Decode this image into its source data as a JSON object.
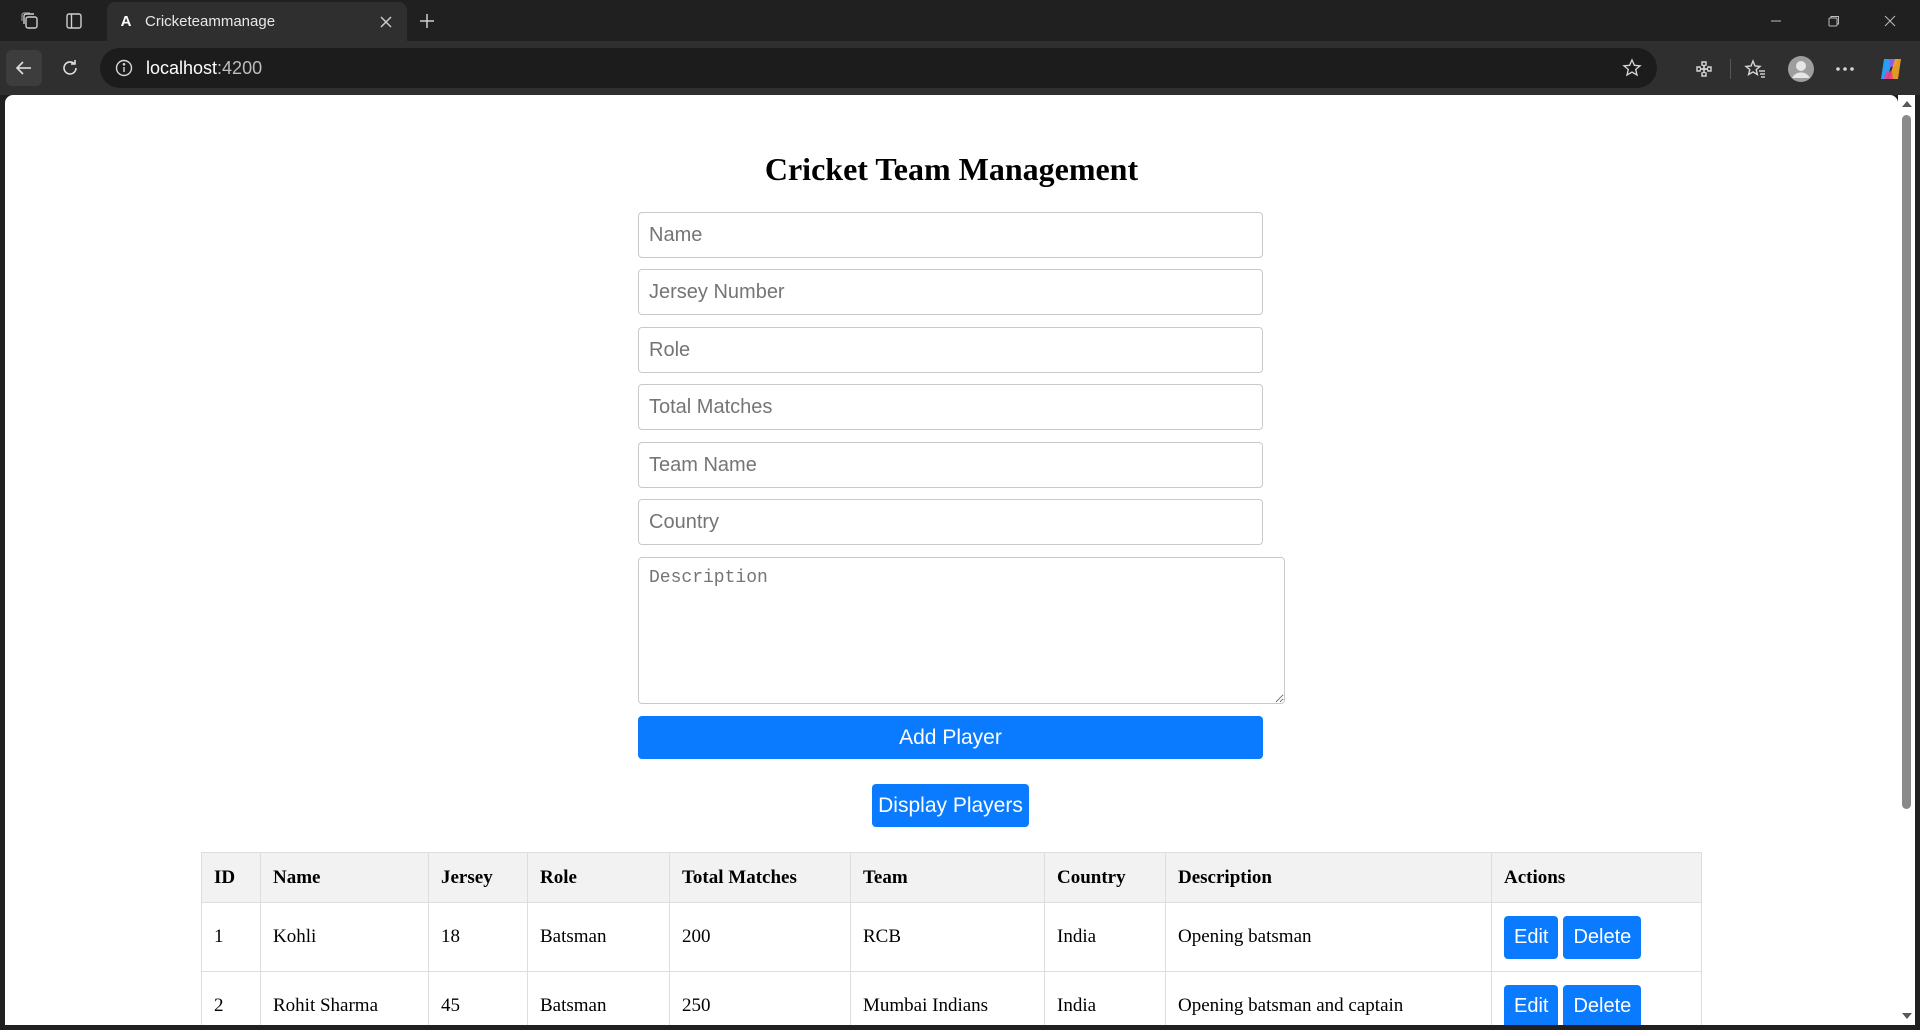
{
  "browser": {
    "tab_title": "Cricketeammanage",
    "tab_favicon": "A",
    "url_host": "localhost",
    "url_port": ":4200"
  },
  "page": {
    "title": "Cricket Team Management",
    "form": {
      "name_placeholder": "Name",
      "jersey_placeholder": "Jersey Number",
      "role_placeholder": "Role",
      "matches_placeholder": "Total Matches",
      "team_placeholder": "Team Name",
      "country_placeholder": "Country",
      "description_placeholder": "Description",
      "add_button": "Add Player"
    },
    "display_button": "Display Players",
    "table": {
      "headers": [
        "ID",
        "Name",
        "Jersey",
        "Role",
        "Total Matches",
        "Team",
        "Country",
        "Description",
        "Actions"
      ],
      "rows": [
        {
          "id": "1",
          "name": "Kohli",
          "jersey": "18",
          "role": "Batsman",
          "matches": "200",
          "team": "RCB",
          "country": "India",
          "description": "Opening batsman",
          "edit": "Edit",
          "delete": "Delete"
        },
        {
          "id": "2",
          "name": "Rohit Sharma",
          "jersey": "45",
          "role": "Batsman",
          "matches": "250",
          "team": "Mumbai Indians",
          "country": "India",
          "description": "Opening batsman and captain",
          "edit": "Edit",
          "delete": "Delete"
        }
      ]
    }
  },
  "colors": {
    "primary_button": "#0a7bff",
    "chrome_dark": "#202020",
    "table_header_bg": "#f2f2f2"
  }
}
